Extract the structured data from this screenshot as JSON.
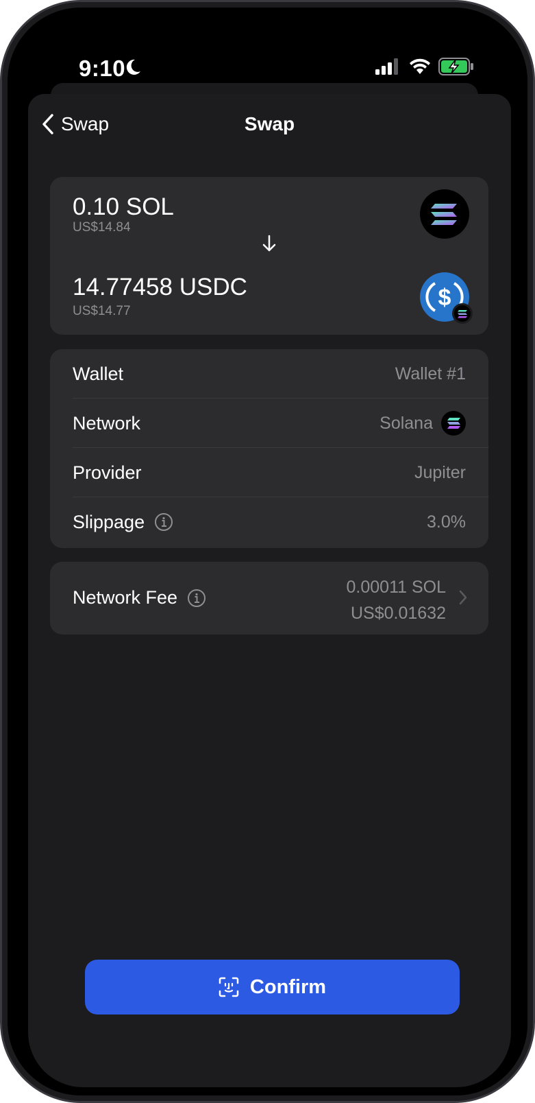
{
  "status_bar": {
    "time": "9:10",
    "icons": [
      "moon-icon",
      "signal-icon",
      "wifi-icon",
      "battery-charging-icon"
    ]
  },
  "nav": {
    "back_label": "Swap",
    "title": "Swap"
  },
  "swap": {
    "from": {
      "amount": "0.10 SOL",
      "fiat": "US$14.84",
      "icon": "solana-token-icon"
    },
    "to": {
      "amount": "14.77458 USDC",
      "fiat": "US$14.77",
      "icon": "usdc-token-icon",
      "network_badge": "solana-badge-icon"
    },
    "direction_icon": "arrow-down-icon"
  },
  "details": {
    "rows": [
      {
        "label": "Wallet",
        "value": "Wallet #1"
      },
      {
        "label": "Network",
        "value": "Solana",
        "icon": "solana-network-icon"
      },
      {
        "label": "Provider",
        "value": "Jupiter"
      },
      {
        "label": "Slippage",
        "value": "3.0%",
        "info_icon": "info-icon"
      }
    ]
  },
  "fee": {
    "label": "Network Fee",
    "amount": "0.00011 SOL",
    "fiat": "US$0.01632"
  },
  "confirm": {
    "label": "Confirm",
    "icon": "face-id-icon"
  },
  "colors": {
    "background": "#000000",
    "sheet": "#1c1c1e",
    "card": "#2c2c2e",
    "secondary_text": "#8e8e93",
    "accent": "#2d5ae3",
    "usdc_blue": "#2775ca",
    "battery_green": "#34c759"
  }
}
